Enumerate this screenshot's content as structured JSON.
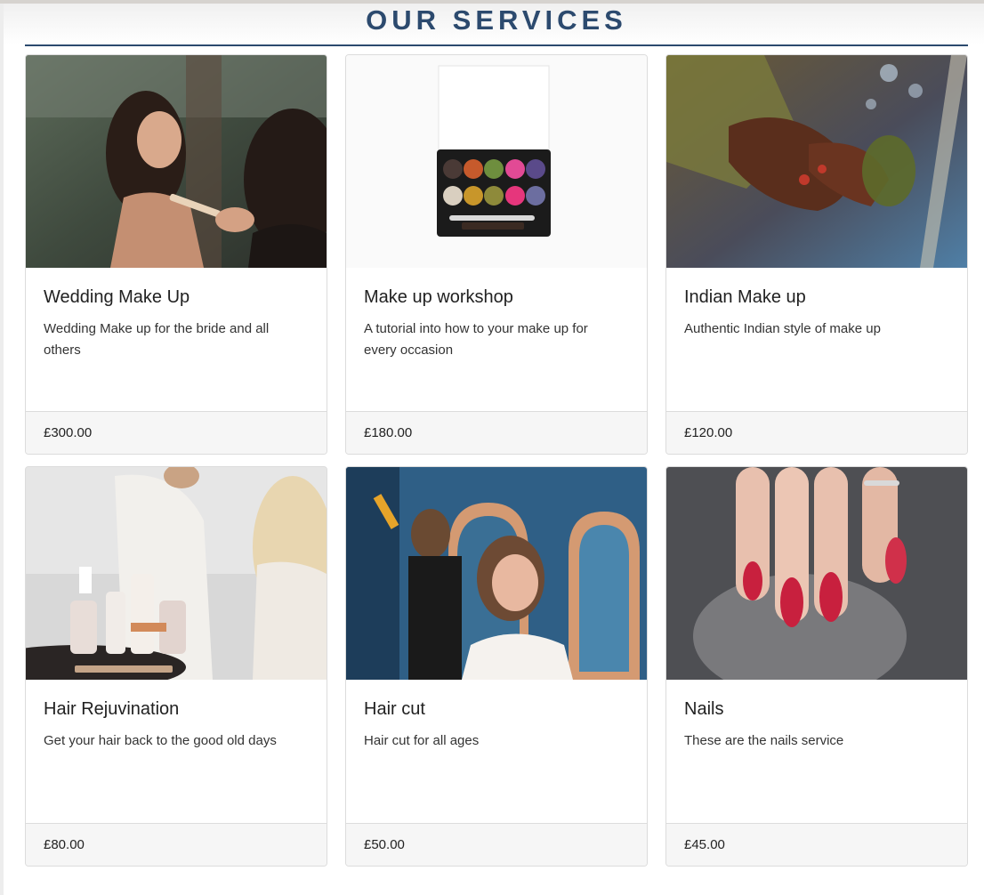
{
  "header": {
    "title": "OUR SERVICES",
    "accent_color": "#2c4a6e"
  },
  "services": [
    {
      "title": "Wedding Make Up",
      "description": "Wedding Make up for the bride and all others",
      "price": "£300.00",
      "image": "wedding-makeup-photo"
    },
    {
      "title": "Make up workshop",
      "description": "A tutorial into how to your make up for every occasion",
      "price": "£180.00",
      "image": "eyeshadow-palette-photo"
    },
    {
      "title": "Indian Make up",
      "description": "Authentic Indian style of make up",
      "price": "£120.00",
      "image": "henna-hands-photo"
    },
    {
      "title": "Hair Rejuvination",
      "description": "Get your hair back to the good old days",
      "price": "£80.00",
      "image": "hair-treatment-photo"
    },
    {
      "title": "Hair cut",
      "description": "Hair cut for all ages",
      "price": "£50.00",
      "image": "hair-salon-photo"
    },
    {
      "title": "Nails",
      "description": "These are the nails service",
      "price": "£45.00",
      "image": "nails-photo"
    }
  ]
}
